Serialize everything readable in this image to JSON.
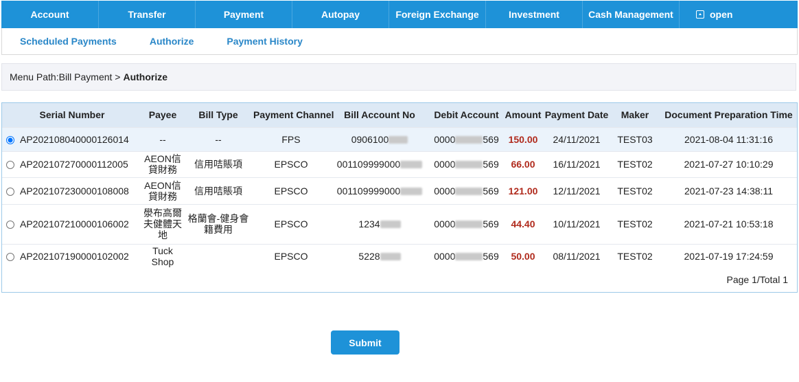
{
  "topnav": {
    "items": [
      "Account",
      "Transfer",
      "Payment",
      "Autopay",
      "Foreign Exchange",
      "Investment",
      "Cash Management"
    ],
    "open_label": "open"
  },
  "subnav": {
    "items": [
      "Scheduled Payments",
      "Authorize",
      "Payment History"
    ]
  },
  "breadcrumb": {
    "prefix": "Menu Path:Bill Payment >",
    "current": "Authorize"
  },
  "table": {
    "headers": [
      "Serial Number",
      "Payee",
      "Bill Type",
      "Payment Channel",
      "Bill Account No",
      "Debit Account",
      "Amount",
      "Payment Date",
      "Maker",
      "Document Preparation Time"
    ],
    "rows": [
      {
        "serial": "AP202108040000126014",
        "payee": "--",
        "bill_type": "--",
        "channel": "FPS",
        "bill_account_prefix": "0906100",
        "debit_prefix": "0000",
        "debit_suffix": "569",
        "amount": "150.00",
        "date": "24/11/2021",
        "maker": "TEST03",
        "prep_time": "2021-08-04 11:31:16"
      },
      {
        "serial": "AP202107270000112005",
        "payee": "AEON信貸財務",
        "bill_type": "信用咭賬項",
        "channel": "EPSCO",
        "bill_account_prefix": "001109999000",
        "debit_prefix": "0000",
        "debit_suffix": "569",
        "amount": "66.00",
        "date": "16/11/2021",
        "maker": "TEST02",
        "prep_time": "2021-07-27 10:10:29"
      },
      {
        "serial": "AP202107230000108008",
        "payee": "AEON信貸財務",
        "bill_type": "信用咭賬項",
        "channel": "EPSCO",
        "bill_account_prefix": "001109999000",
        "debit_prefix": "0000",
        "debit_suffix": "569",
        "amount": "121.00",
        "date": "12/11/2021",
        "maker": "TEST02",
        "prep_time": "2021-07-23 14:38:11"
      },
      {
        "serial": "AP202107210000106002",
        "payee": "澩布高爾夫健體天地",
        "bill_type": "格蘭會-健身會籍費用",
        "channel": "EPSCO",
        "bill_account_prefix": "1234",
        "debit_prefix": "0000",
        "debit_suffix": "569",
        "amount": "44.40",
        "date": "10/11/2021",
        "maker": "TEST02",
        "prep_time": "2021-07-21 10:53:18"
      },
      {
        "serial": "AP202107190000102002",
        "payee": "Tuck Shop",
        "bill_type": "",
        "channel": "EPSCO",
        "bill_account_prefix": "5228",
        "debit_prefix": "0000",
        "debit_suffix": "569",
        "amount": "50.00",
        "date": "08/11/2021",
        "maker": "TEST02",
        "prep_time": "2021-07-19 17:24:59"
      }
    ],
    "pagination": "Page 1/Total 1"
  },
  "submit_label": "Submit",
  "colors": {
    "primary": "#1e92d8",
    "link": "#2a87c8",
    "amount": "#b02a1c",
    "header_bg": "#dde9f5"
  }
}
